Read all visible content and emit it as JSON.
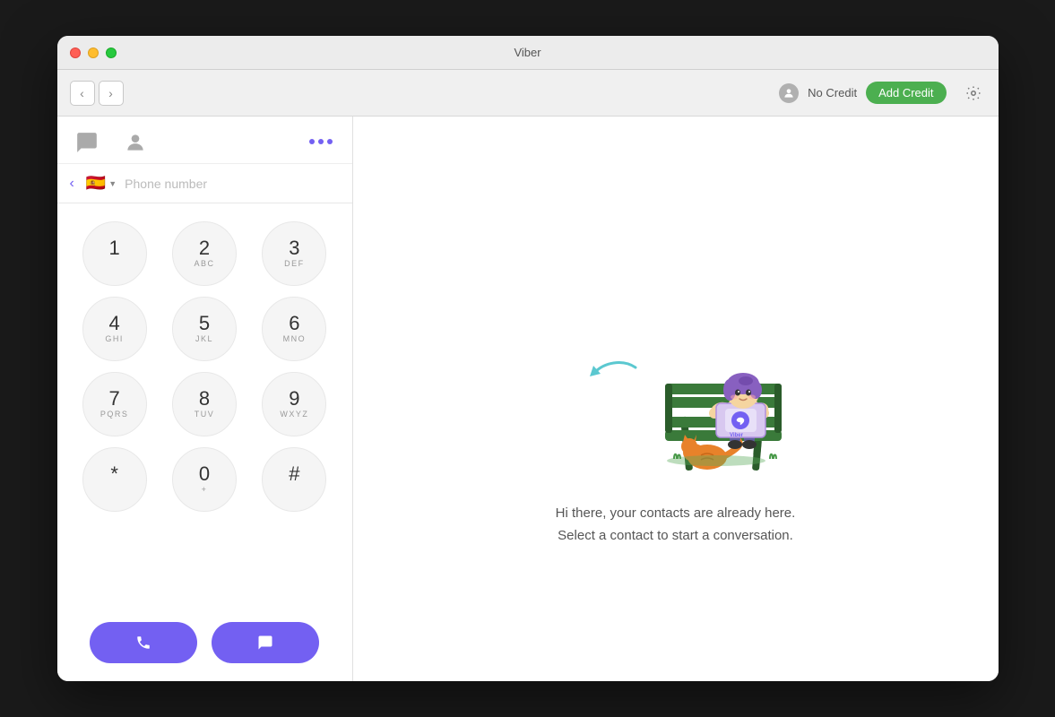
{
  "window": {
    "title": "Viber"
  },
  "titlebar": {
    "title": "Viber",
    "controls": {
      "close": "close",
      "minimize": "minimize",
      "maximize": "maximize"
    }
  },
  "toolbar": {
    "back_label": "‹",
    "forward_label": "›",
    "no_credit_label": "No Credit",
    "add_credit_label": "Add Credit"
  },
  "left_panel": {
    "tabs": [
      {
        "id": "chat",
        "label": "Chat",
        "active": false
      },
      {
        "id": "contacts",
        "label": "Contacts",
        "active": false
      },
      {
        "id": "more",
        "label": "More",
        "active": true
      }
    ],
    "phone_input": {
      "placeholder": "Phone number",
      "flag": "🇪🇸",
      "country_code": "ES"
    },
    "dialpad": {
      "keys": [
        {
          "number": "1",
          "letters": ""
        },
        {
          "number": "2",
          "letters": "ABC"
        },
        {
          "number": "3",
          "letters": "DEF"
        },
        {
          "number": "4",
          "letters": "GHI"
        },
        {
          "number": "5",
          "letters": "JKL"
        },
        {
          "number": "6",
          "letters": "MNO"
        },
        {
          "number": "7",
          "letters": "PQRS"
        },
        {
          "number": "8",
          "letters": "TUV"
        },
        {
          "number": "9",
          "letters": "WXYZ"
        },
        {
          "number": "*",
          "letters": ""
        },
        {
          "number": "0",
          "letters": "+"
        },
        {
          "number": "#",
          "letters": ""
        }
      ]
    },
    "actions": {
      "call_label": "Call",
      "message_label": "Message"
    }
  },
  "right_panel": {
    "welcome_line1": "Hi there, your contacts are already here.",
    "welcome_line2": "Select a contact to start a conversation."
  }
}
